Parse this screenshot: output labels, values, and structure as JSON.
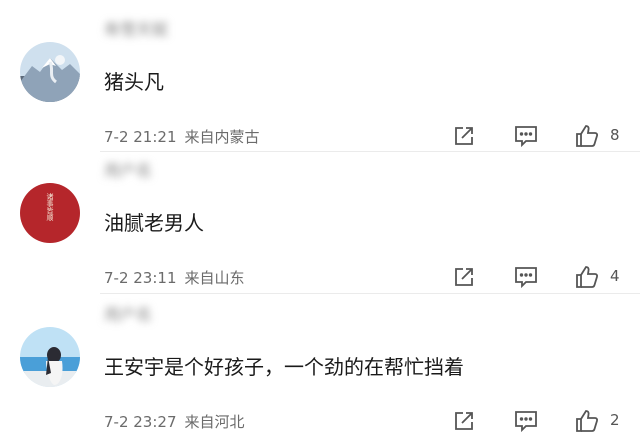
{
  "comments": [
    {
      "username": "寿雪天赋",
      "content": "猪头凡",
      "time": "7-2 21:21",
      "location": "来自内蒙古",
      "likes": "8",
      "avatar_icon": "snowy-mountain-avatar"
    },
    {
      "username": "用户名",
      "content": "油腻老男人",
      "time": "7-2 23:11",
      "location": "来自山东",
      "likes": "4",
      "avatar_icon": "red-seal-avatar",
      "avatar_text": "诸事皆顺"
    },
    {
      "username": "用户名",
      "content": "王安宇是个好孩子，一个劲的在帮忙挡着",
      "time": "7-2 23:27",
      "location": "来自河北",
      "likes": "2",
      "avatar_icon": "beach-girl-avatar"
    }
  ],
  "colors": {
    "accent_red": "#b5262b",
    "sky_blue": "#4a9fd8",
    "text_gray": "#6b6b6b"
  },
  "icons": [
    "share-icon",
    "comment-icon",
    "thumbs-up-icon"
  ]
}
